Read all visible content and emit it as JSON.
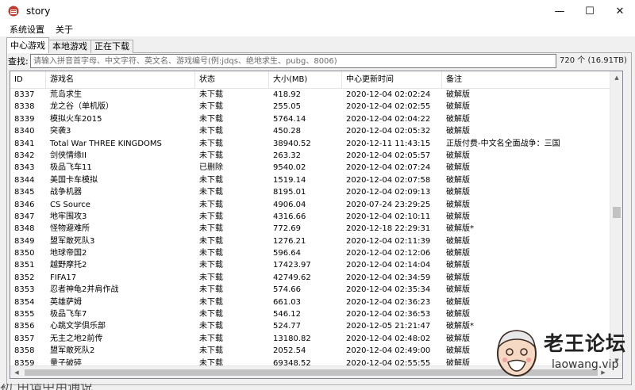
{
  "window": {
    "title": "story",
    "minimize": "—",
    "maximize": "☐",
    "close": "✕"
  },
  "menu": [
    "系统设置",
    "关于"
  ],
  "tabs": [
    {
      "label": "中心游戏",
      "active": true
    },
    {
      "label": "本地游戏",
      "active": false
    },
    {
      "label": "正在下载",
      "active": false
    }
  ],
  "search": {
    "label": "查找:",
    "value": "",
    "placeholder": "请输入拼音首字母、中文字符、英文名、游戏编号(例:jdqs、绝地求生、pubg、8006)"
  },
  "count": "720 个 (16.91TB)",
  "table": {
    "columns": [
      "ID",
      "游戏名",
      "状态",
      "大小(MB)",
      "中心更新时间",
      "备注"
    ],
    "rows": [
      [
        "8337",
        "荒岛求生",
        "未下载",
        "418.92",
        "2020-12-04 02:02:24",
        "破解版"
      ],
      [
        "8338",
        "龙之谷（单机版）",
        "未下载",
        "255.05",
        "2020-12-04 02:02:55",
        "破解版"
      ],
      [
        "8339",
        "模拟火车2015",
        "未下载",
        "5764.14",
        "2020-12-04 02:04:22",
        "破解版"
      ],
      [
        "8340",
        "突袭3",
        "未下载",
        "450.28",
        "2020-12-04 02:05:32",
        "破解版"
      ],
      [
        "8341",
        "Total War THREE KINGDOMS",
        "未下载",
        "38940.52",
        "2020-12-11 11:43:15",
        "正版付费-中文名全面战争：三国"
      ],
      [
        "8342",
        "剑侠情缘II",
        "未下载",
        "263.32",
        "2020-12-04 02:05:57",
        "破解版"
      ],
      [
        "8343",
        "极品飞车11",
        "已删除",
        "9540.02",
        "2020-12-04 02:07:24",
        "破解版"
      ],
      [
        "8344",
        "美国卡车模拟",
        "未下载",
        "1519.14",
        "2020-12-04 02:07:58",
        "破解版"
      ],
      [
        "8345",
        "战争机器",
        "未下载",
        "8195.01",
        "2020-12-04 02:09:13",
        "破解版"
      ],
      [
        "8346",
        "CS Source",
        "未下载",
        "4906.04",
        "2020-07-24 23:29:25",
        "破解版"
      ],
      [
        "8347",
        "地牢围攻3",
        "未下载",
        "4316.66",
        "2020-12-04 02:10:11",
        "破解版"
      ],
      [
        "8348",
        "怪物避难所",
        "未下载",
        "772.69",
        "2020-12-18 22:29:31",
        "破解版*"
      ],
      [
        "8349",
        "盟军敢死队3",
        "未下载",
        "1276.21",
        "2020-12-04 02:11:39",
        "破解版"
      ],
      [
        "8350",
        "地球帝国2",
        "未下载",
        "596.64",
        "2020-12-04 02:12:06",
        "破解版"
      ],
      [
        "8351",
        "越野摩托2",
        "未下载",
        "17423.97",
        "2020-12-04 02:14:04",
        "破解版"
      ],
      [
        "8352",
        "FIFA17",
        "未下载",
        "42749.62",
        "2020-12-04 02:34:59",
        "破解版"
      ],
      [
        "8353",
        "忍者神龟2并肩作战",
        "未下载",
        "574.66",
        "2020-12-04 02:35:34",
        "破解版"
      ],
      [
        "8354",
        "英雄萨姆",
        "未下载",
        "661.03",
        "2020-12-04 02:36:23",
        "破解版"
      ],
      [
        "8355",
        "极品飞车7",
        "未下载",
        "546.12",
        "2020-12-04 02:36:53",
        "破解版"
      ],
      [
        "8356",
        "心跳文学俱乐部",
        "未下载",
        "524.77",
        "2020-12-05 21:21:47",
        "破解版*"
      ],
      [
        "8357",
        "无主之地2前传",
        "未下载",
        "13180.82",
        "2020-12-04 02:48:02",
        "破解版"
      ],
      [
        "8358",
        "盟军敢死队2",
        "未下载",
        "2052.54",
        "2020-12-04 02:49:00",
        "破解版"
      ],
      [
        "8359",
        "量子破碎",
        "未下载",
        "69348.52",
        "2020-12-04 02:55:55",
        "破解版"
      ]
    ]
  },
  "watermark": {
    "title": "老王论坛",
    "url": "laowang.vip"
  },
  "behind": "初 由请中用通说",
  "icons": {
    "app": "app-logo-icon",
    "up": "▲",
    "down": "▼",
    "left": "◀",
    "right": "▶"
  }
}
